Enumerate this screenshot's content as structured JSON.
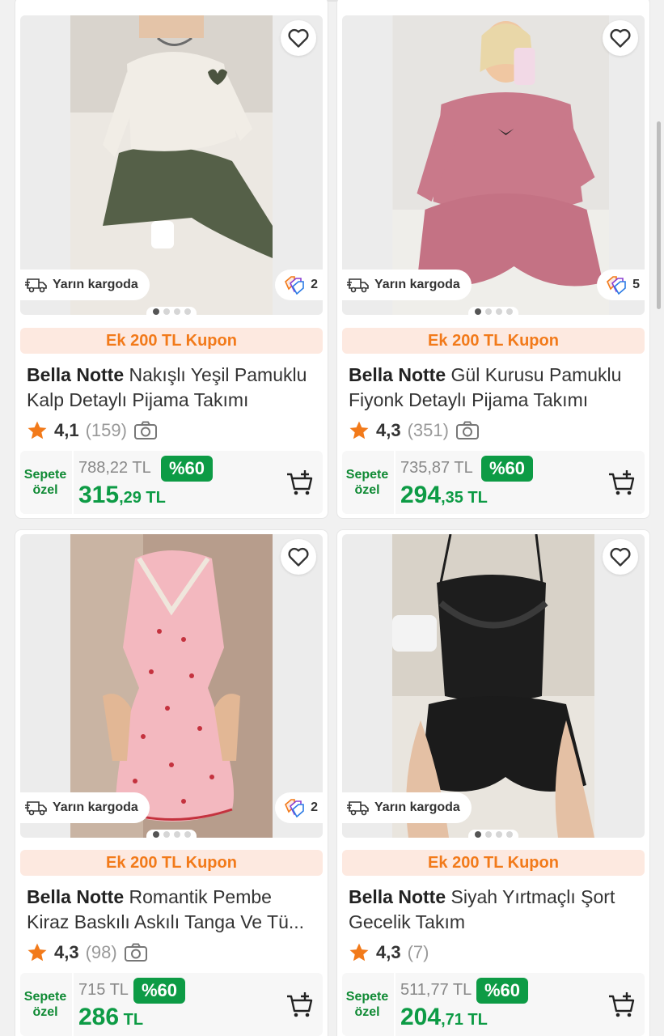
{
  "colors": {
    "accent_orange": "#f27a1a",
    "discount_green": "#0d9b45",
    "coupon_bg": "#fde9e0",
    "star": "#f27a1a"
  },
  "icons": {
    "favorite": "heart-icon",
    "shipping": "truck-icon",
    "tags": "tags-icon",
    "photo": "camera-icon",
    "cart": "add-to-cart-icon",
    "rating": "star-icon"
  },
  "products": [
    {
      "shipping": "Yarın kargoda",
      "tag_count": "2",
      "coupon": "Ek 200 TL Kupon",
      "brand": "Bella Notte",
      "name_line1": "Nakışlı Yeşil Pamuklu",
      "name_line2": "Kalp Detaylı Pijama Takımı",
      "rating": "4,1",
      "review_count": "(159)",
      "sepete_line1": "Sepete",
      "sepete_line2": "özel",
      "old_price": "788,22 TL",
      "discount": "%60",
      "price_int": "315",
      "price_dec": ",29 TL"
    },
    {
      "shipping": "Yarın kargoda",
      "tag_count": "5",
      "coupon": "Ek 200 TL Kupon",
      "brand": "Bella Notte",
      "name_line1": "Gül Kurusu Pamuklu",
      "name_line2": "Fiyonk Detaylı Pijama Takımı",
      "rating": "4,3",
      "review_count": "(351)",
      "sepete_line1": "Sepete",
      "sepete_line2": "özel",
      "old_price": "735,87 TL",
      "discount": "%60",
      "price_int": "294",
      "price_dec": ",35 TL"
    },
    {
      "shipping": "Yarın kargoda",
      "tag_count": "2",
      "coupon": "Ek 200 TL Kupon",
      "brand": "Bella Notte",
      "name_line1": "Romantik Pembe",
      "name_line2": "Kiraz Baskılı Askılı Tanga Ve Tü...",
      "rating": "4,3",
      "review_count": "(98)",
      "sepete_line1": "Sepete",
      "sepete_line2": "özel",
      "old_price": "715 TL",
      "discount": "%60",
      "price_int": "286",
      "price_dec": " TL"
    },
    {
      "shipping": "Yarın kargoda",
      "coupon": "Ek 200 TL Kupon",
      "brand": "Bella Notte",
      "name_line1": "Siyah Yırtmaçlı Şort",
      "name_line2": "Gecelik Takım",
      "rating": "4,3",
      "review_count": "(7)",
      "sepete_line1": "Sepete",
      "sepete_line2": "özel",
      "old_price": "511,77 TL",
      "discount": "%60",
      "price_int": "204",
      "price_dec": ",71 TL"
    }
  ]
}
